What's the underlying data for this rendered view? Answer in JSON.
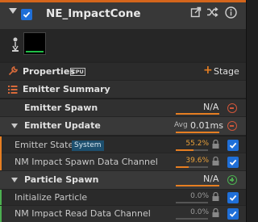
{
  "header": {
    "title": "NE_ImpactCone",
    "enabled": true
  },
  "properties": {
    "label": "Properties",
    "cpu_badge": "CPU",
    "stage_label": "Stage"
  },
  "emitter_summary": {
    "label": "Emitter Summary"
  },
  "emitter_spawn": {
    "label": "Emitter Spawn",
    "value": "N/A"
  },
  "emitter_update": {
    "label": "Emitter Update",
    "avg_label": "Avg",
    "avg_value": "0.01ms"
  },
  "modules_update": [
    {
      "label": "Emitter State",
      "badge": "System",
      "percent": "55.2%",
      "fraction": 0.552,
      "enabled": true
    },
    {
      "label": "NM Impact Spawn Data Channel",
      "badge": "",
      "percent": "39.6%",
      "fraction": 0.396,
      "enabled": true
    }
  ],
  "particle_spawn": {
    "label": "Particle Spawn",
    "value": "N/A"
  },
  "modules_spawn": [
    {
      "label": "Initialize Particle",
      "percent": "0.0%",
      "fraction": 0.0,
      "enabled": true
    },
    {
      "label": "NM Impact Read Data Channel",
      "percent": "0.0%",
      "fraction": 0.0,
      "enabled": true
    }
  ],
  "colors": {
    "accent": "#e67e22",
    "checkbox": "#1f6fd8",
    "header_stripe": "#d4651c",
    "spawn_mark": "#4caf50",
    "update_mark": "#e67e22"
  }
}
